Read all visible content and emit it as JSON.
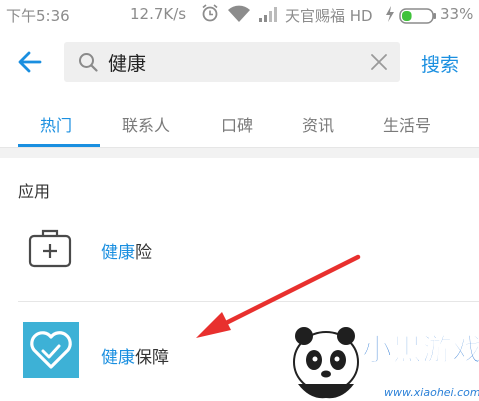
{
  "status_bar": {
    "time": "下午5:36",
    "speed": "12.7K/s",
    "carrier": "天官赐福 HD",
    "battery_percent": "33%",
    "battery_level": 0.33
  },
  "header": {
    "query": "健康",
    "search_label": "搜索"
  },
  "tabs": [
    {
      "label": "热门",
      "active": true
    },
    {
      "label": "联系人",
      "active": false
    },
    {
      "label": "口碑",
      "active": false
    },
    {
      "label": "资讯",
      "active": false
    },
    {
      "label": "生活号",
      "active": false
    }
  ],
  "section": {
    "title": "应用",
    "items": [
      {
        "highlight": "健康",
        "rest": "险",
        "icon": "medical-kit-icon"
      },
      {
        "highlight": "健康",
        "rest": "保障",
        "icon": "heart-shield-icon"
      }
    ]
  },
  "watermark": {
    "brand": "小黑游戏",
    "url": "www.xiaohei.com"
  },
  "colors": {
    "accent": "#1a8fe0",
    "arrow": "#e8302e",
    "tile": "#3db1d6"
  }
}
